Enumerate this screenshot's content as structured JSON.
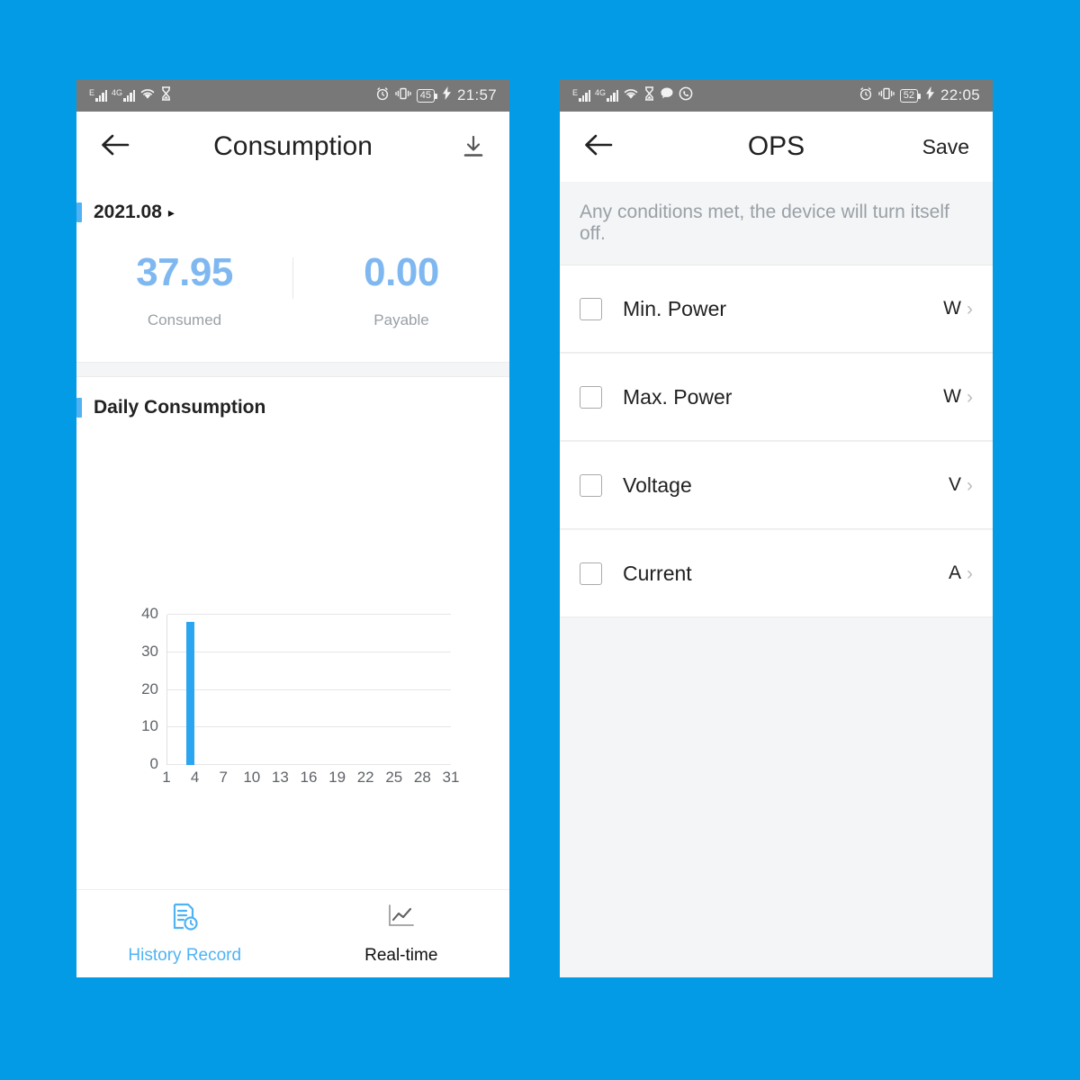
{
  "page": {
    "background_color": "#039BE5"
  },
  "phones": {
    "left": {
      "status_bar": {
        "network_1": "E",
        "network_2": "4G",
        "icons": [
          "signal-icon",
          "signal-icon",
          "wifi-icon",
          "hourglass-icon",
          "alarm-icon",
          "vibrate-icon"
        ],
        "battery": "45",
        "charging": true,
        "time": "21:57"
      },
      "header": {
        "back_icon": "back-arrow-icon",
        "title": "Consumption",
        "action_icon": "download-icon"
      },
      "period": {
        "label": "2021.08",
        "caret": "▸"
      },
      "summary": [
        {
          "value": "37.95",
          "label": "Consumed"
        },
        {
          "value": "0.00",
          "label": "Payable"
        }
      ],
      "chart_section_title": "Daily Consumption",
      "bottom_nav": [
        {
          "label": "History Record",
          "icon": "history-record-icon",
          "active": true
        },
        {
          "label": "Real-time",
          "icon": "line-chart-icon",
          "active": false
        }
      ],
      "colors": {
        "value_blue": "#7FB8F0",
        "accent_blue": "#4FB3F3",
        "bar_blue": "#2BA5F0"
      }
    },
    "right": {
      "status_bar": {
        "network_1": "E",
        "network_2": "4G",
        "icons": [
          "signal-icon",
          "signal-icon",
          "wifi-icon",
          "hourglass-icon",
          "chat-icon",
          "whatsapp-icon",
          "alarm-icon",
          "vibrate-icon"
        ],
        "battery": "52",
        "charging": true,
        "time": "22:05"
      },
      "header": {
        "back_icon": "back-arrow-icon",
        "title": "OPS",
        "save_label": "Save"
      },
      "hint": "Any conditions met, the device will turn itself off.",
      "rows": [
        {
          "label": "Min. Power",
          "unit": "W",
          "checked": false
        },
        {
          "label": "Max. Power",
          "unit": "W",
          "checked": false
        },
        {
          "label": "Voltage",
          "unit": "V",
          "checked": false
        },
        {
          "label": "Current",
          "unit": "A",
          "checked": false
        }
      ],
      "chevron": "›"
    }
  },
  "chart_data": {
    "type": "bar",
    "title": "Daily Consumption",
    "xlabel": "",
    "ylabel": "",
    "ylim": [
      0,
      40
    ],
    "yticks": [
      0,
      10,
      20,
      30,
      40
    ],
    "xticks": [
      1,
      4,
      7,
      10,
      13,
      16,
      19,
      22,
      25,
      28,
      31
    ],
    "x_range": [
      1,
      31
    ],
    "grid": true,
    "legend": "none",
    "categories": [
      1,
      2,
      3,
      4,
      5,
      6,
      7,
      8,
      9,
      10,
      11,
      12,
      13,
      14,
      15,
      16,
      17,
      18,
      19,
      20,
      21,
      22,
      23,
      24,
      25,
      26,
      27,
      28,
      29,
      30,
      31
    ],
    "values": [
      0,
      0,
      38,
      0,
      0,
      0,
      0,
      0,
      0,
      0,
      0,
      0,
      0,
      0,
      0,
      0,
      0,
      0,
      0,
      0,
      0,
      0,
      0,
      0,
      0,
      0,
      0,
      0,
      0,
      0,
      0
    ],
    "bar_color": "#2BA5F0"
  }
}
